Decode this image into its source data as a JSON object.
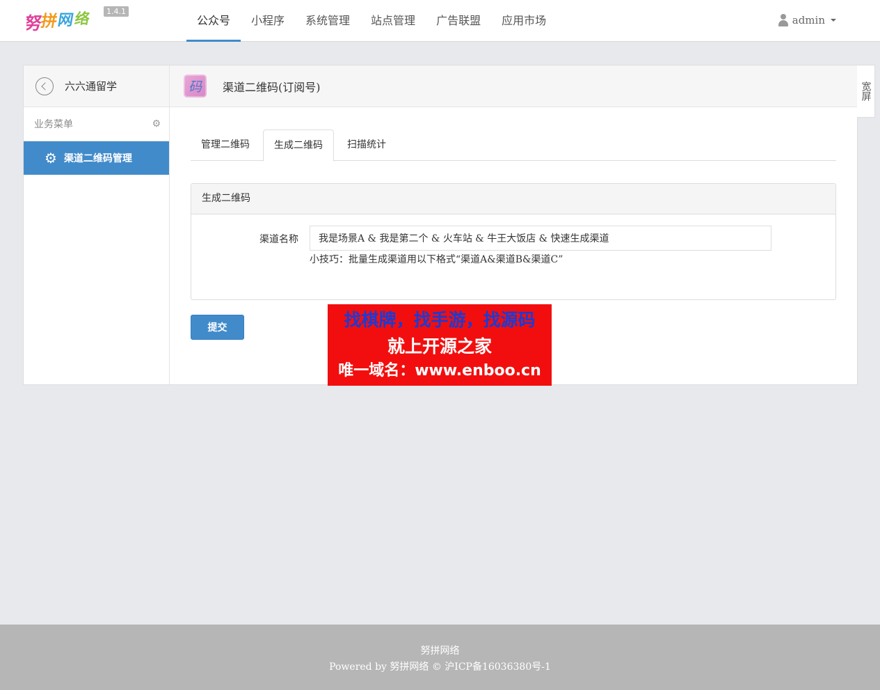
{
  "header": {
    "logo_text": "努拼网络",
    "version": "1.4.1",
    "nav": [
      {
        "label": "公众号",
        "active": true
      },
      {
        "label": "小程序"
      },
      {
        "label": "系统管理"
      },
      {
        "label": "站点管理"
      },
      {
        "label": "广告联盟"
      },
      {
        "label": "应用市场"
      }
    ],
    "user": "admin"
  },
  "sidebar": {
    "account_name": "六六通留学",
    "menu_title": "业务菜单",
    "active_item": "渠道二维码管理"
  },
  "content": {
    "icon_char": "码",
    "title": "渠道二维码(订阅号)",
    "tabs": [
      "管理二维码",
      "生成二维码",
      "扫描统计"
    ],
    "box_title": "生成二维码",
    "field_label": "渠道名称",
    "field_value": "我是场景A & 我是第二个 & 火车站 & 牛王大饭店 & 快速生成渠道",
    "tip": "小技巧：批量生成渠道用以下格式“渠道A&渠道B&渠道C”",
    "submit_label": "提交"
  },
  "ad": {
    "line1": "找棋牌，找手游，找源码",
    "line2": "就上开源之家",
    "line3": "唯一域名：www.enboo.cn"
  },
  "wide_button": "宽屏",
  "footer": {
    "line1": "努拼网络",
    "line2": "Powered by 努拼网络 © 沪ICP备16036380号-1"
  },
  "colors": {
    "primary": "#428bca",
    "ad_background": "#f20e0e",
    "footer_background": "#b5b6b5"
  }
}
